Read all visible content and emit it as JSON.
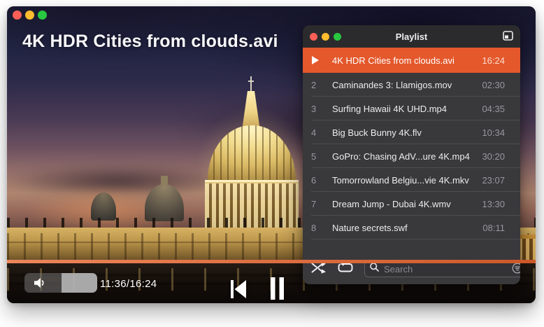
{
  "player_window": {
    "window_controls": {
      "close_color": "#ff5f57",
      "minimize_color": "#febc2e",
      "zoom_color": "#28c840"
    },
    "title_overlay": "4K HDR Cities from clouds.avi",
    "progress": {
      "time_display": "11:36/16:24",
      "current_time": "11:36",
      "total_time": "16:24",
      "bar_color": "#e8642e"
    },
    "controls": {
      "volume_icon": "speaker-icon",
      "previous_icon": "previous-track-icon",
      "pause_icon": "pause-icon"
    }
  },
  "playlist_window": {
    "title": "Playlist",
    "window_controls": {
      "close_color": "#ff5f57",
      "minimize_color": "#febc2e",
      "zoom_color": "#28c840"
    },
    "dock_icon": "dock-playlist-icon",
    "items": [
      {
        "number": "",
        "title": "4K HDR Cities from clouds.avi",
        "duration": "16:24",
        "status": "playing"
      },
      {
        "number": "2",
        "title": "Caminandes 3: Llamigos.mov",
        "duration": "02:30"
      },
      {
        "number": "3",
        "title": "Surfing Hawaii 4K UHD.mp4",
        "duration": "04:35"
      },
      {
        "number": "4",
        "title": "Big Buck Bunny 4K.flv",
        "duration": "10:34"
      },
      {
        "number": "5",
        "title": "GoPro: Chasing AdV...ure 4K.mp4",
        "duration": "30:20"
      },
      {
        "number": "6",
        "title": "Tomorrowland Belgiu...vie 4K.mkv",
        "duration": "23:07"
      },
      {
        "number": "7",
        "title": "Dream Jump - Dubai 4K.wmv",
        "duration": "13:30"
      },
      {
        "number": "8",
        "title": "Nature secrets.swf",
        "duration": "08:11"
      }
    ],
    "bottom_bar": {
      "shuffle_icon": "shuffle-icon",
      "repeat_icon": "repeat-icon",
      "search_placeholder": "Search",
      "filter_icon": "search-filter-icon"
    },
    "colors": {
      "active_row": "#e4582c",
      "header_bg": "#2b2b2d",
      "row_bg": "#39383b"
    }
  }
}
